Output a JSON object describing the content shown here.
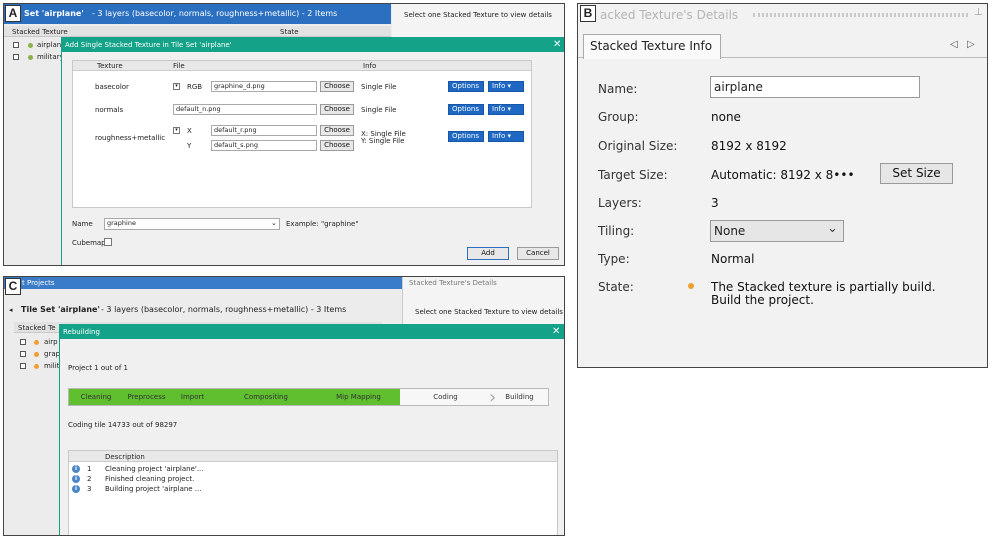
{
  "panel_labels": {
    "a": "A",
    "b": "B",
    "c": "C"
  },
  "panel_a": {
    "header_title": "Set 'airplane'",
    "header_subtitle": "- 3 layers (basecolor, normals, roughness+metallic) - 2 Items",
    "right_hint": "Select one Stacked Texture to view details",
    "col_stacked": "Stacked Texture",
    "col_state": "State",
    "tree": [
      "airplane",
      "military"
    ],
    "dialog": {
      "title": "Add Single Stacked Texture in Tile Set 'airplane'",
      "columns": {
        "texture": "Texture",
        "file": "File",
        "info": "Info"
      },
      "rows": [
        {
          "texture": "basecolor",
          "channel": "RGB",
          "file": "graphine_d.png",
          "choose": "Choose",
          "info": "Single File",
          "options": "Options",
          "info_btn": "Info"
        },
        {
          "texture": "normals",
          "file": "default_n.png",
          "choose": "Choose",
          "info": "Single File",
          "options": "Options",
          "info_btn": "Info"
        },
        {
          "texture": "roughness+metallic",
          "channel_x": "X",
          "channel_y": "Y",
          "file_x": "default_r.png",
          "file_y": "default_s.png",
          "choose": "Choose",
          "info_x": "X: Single File",
          "info_y": "Y: Single File",
          "options": "Options",
          "info_btn": "Info"
        }
      ],
      "name_label": "Name",
      "name_value": "graphine",
      "name_example": "Example: \"graphine\"",
      "cubemap_label": "Cubemap",
      "add": "Add",
      "cancel": "Cancel"
    }
  },
  "panel_b": {
    "window_title": "acked Texture's Details",
    "tab": "Stacked Texture Info",
    "fields": {
      "name_label": "Name:",
      "name_value": "airplane",
      "group_label": "Group:",
      "group_value": "none",
      "orig_label": "Original Size:",
      "orig_value": "8192 x 8192",
      "target_label": "Target Size:",
      "target_value": "Automatic: 8192 x 8•••",
      "set_size": "Set Size",
      "layers_label": "Layers:",
      "layers_value": "3",
      "tiling_label": "Tiling:",
      "tiling_value": "None",
      "type_label": "Type:",
      "type_value": "Normal",
      "state_label": "State:",
      "state_line1": "The Stacked texture is partially build.",
      "state_line2": "Build the project."
    }
  },
  "panel_c": {
    "top_title": "t Projects",
    "right_title": "Stacked Texture's Details",
    "header_title": "Tile Set 'airplane'",
    "header_subtitle": "- 3 layers (basecolor, normals, roughness+metallic) - 3 Items",
    "right_hint": "Select one Stacked Texture to view details",
    "col_stacked": "Stacked Te",
    "tree": [
      "airp",
      "grap",
      "milit"
    ],
    "dialog": {
      "title": "Rebuilding",
      "project_line": "Project 1 out of 1",
      "steps_done": [
        "Cleaning",
        "Preprocess",
        "Import",
        "Compositing",
        "Mip Mapping"
      ],
      "steps_todo": [
        "Coding",
        "Building"
      ],
      "coding_line": "Coding tile 14733 out of 98297",
      "log_header": "Description",
      "log": [
        {
          "n": "1",
          "text": "Cleaning project 'airplane'..."
        },
        {
          "n": "2",
          "text": "Finished cleaning project."
        },
        {
          "n": "3",
          "text": "Building project 'airplane ..."
        }
      ]
    }
  }
}
